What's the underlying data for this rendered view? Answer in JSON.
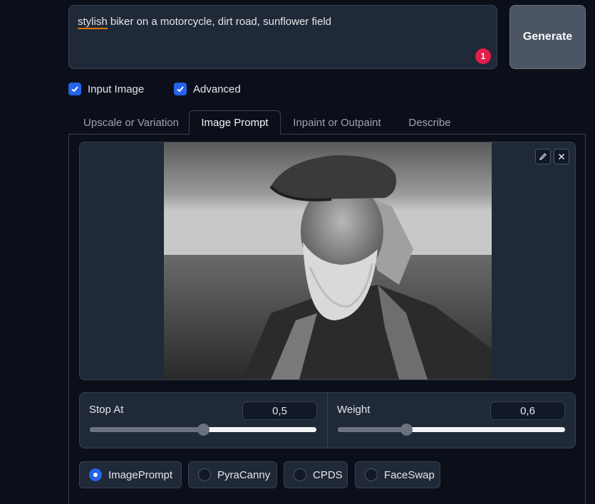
{
  "prompt": {
    "text_misspelled": "stylish",
    "text_rest": " biker on a motorcycle, dirt road, sunflower field",
    "error_count": "1"
  },
  "generate": {
    "label": "Generate"
  },
  "options": {
    "input_image": {
      "label": "Input Image",
      "checked": true
    },
    "advanced": {
      "label": "Advanced",
      "checked": true
    }
  },
  "tabs": [
    {
      "label": "Upscale or Variation"
    },
    {
      "label": "Image Prompt",
      "active": true
    },
    {
      "label": "Inpaint or Outpaint"
    },
    {
      "label": "Describe"
    }
  ],
  "image_tools": {
    "edit_icon": "pencil-icon",
    "close_icon": "close-icon"
  },
  "sliders": {
    "stop_at": {
      "label": "Stop At",
      "value": "0,5",
      "fraction": 0.5
    },
    "weight": {
      "label": "Weight",
      "value": "0,6",
      "fraction": 0.3
    }
  },
  "ip_types": [
    {
      "label": "ImagePrompt",
      "selected": true
    },
    {
      "label": "PyraCanny",
      "selected": false
    },
    {
      "label": "CPDS",
      "selected": false
    },
    {
      "label": "FaceSwap",
      "selected": false
    }
  ],
  "colors": {
    "accent": "#2563eb",
    "badge": "#e11d48",
    "background": "#0b0f19",
    "panel": "#1f2937"
  }
}
